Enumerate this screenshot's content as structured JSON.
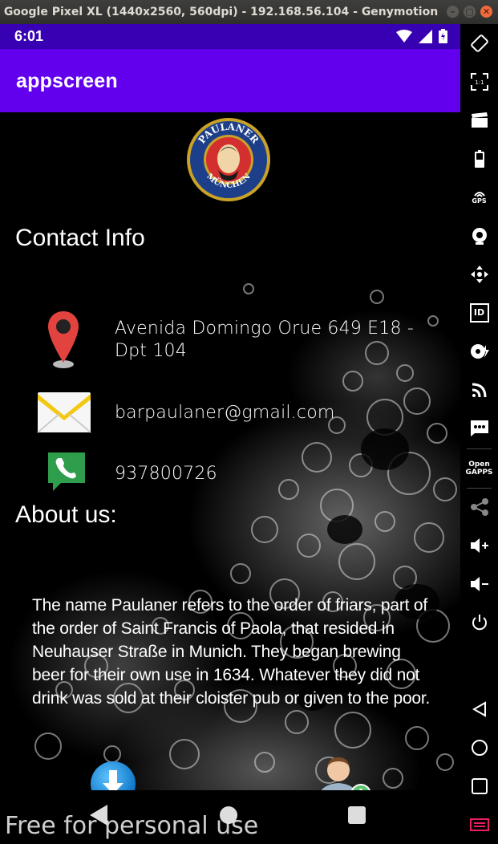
{
  "window": {
    "title": "Google Pixel XL (1440x2560, 560dpi) - 192.168.56.104 - Genymotion",
    "buttons": [
      "–",
      "▢",
      "✕"
    ]
  },
  "status_bar": {
    "time": "6:01"
  },
  "app_bar": {
    "title": "appscreen"
  },
  "logo": {
    "top_text": "PAULANER",
    "bottom_text": "MÜNCHEN"
  },
  "contact": {
    "heading": "Contact Info",
    "address": "Avenida Domingo Orue 649 E18 - Dpt 104",
    "email": "barpaulaner@gmail.com",
    "phone": "937800726"
  },
  "about": {
    "heading": "About us:",
    "text": "The name Paulaner refers to the order of friars, part of the order of Saint Francis of Paola, that resided in Neuhauser Straße in Munich. They began brewing beer for their own use in 1634. Whatever they did not drink was sold at their cloister pub or given to the poor."
  },
  "toolbar": {
    "items": [
      "rotate-icon",
      "pixel-perfect-icon",
      "capture-icon",
      "battery-icon",
      "gps-icon",
      "camera-icon",
      "move-icon",
      "identifiers-icon",
      "disk-io-icon",
      "network-icon",
      "sms-icon",
      "open-gapps-icon",
      "share-icon",
      "volume-up-icon",
      "volume-down-icon",
      "power-icon",
      "back-icon",
      "home-icon",
      "recent-apps-icon",
      "menu-icon"
    ],
    "gps_label": "GPS",
    "id_label": "ID",
    "open_gapps_label": "Open GAPPS"
  },
  "watermark": "Free for personal use",
  "colors": {
    "status_bar": "#3700b3",
    "app_bar": "#6200ee",
    "accent_pink": "#e91e63"
  }
}
